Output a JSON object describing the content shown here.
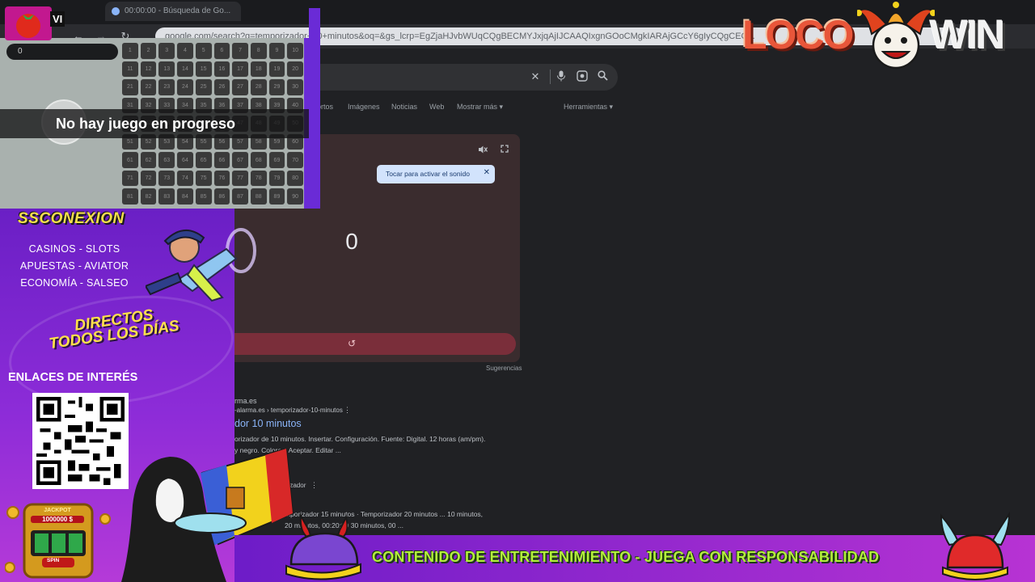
{
  "browser": {
    "tab_title": "00:00:00 - Búsqueda de Go...",
    "url": "google.com/search?q=temporizador+10+minutos&oq=&gs_lcrp=EgZjaHJvbWUqCQgBECMYJxjqAjIJCAAQIxgnGOoCMgkIARAjGCcY6gIyCQgCEC...",
    "tabs": [
      "Imágenes",
      "Noticias",
      "Web",
      "Mostrar más",
      "Herramientas"
    ],
    "tab_partial": "ortos"
  },
  "timer": {
    "value": "0",
    "tooltip": "Tocar para activar el sonido",
    "tooltip_close": "✕",
    "reset": "↺",
    "suggestions": "Sugerencias",
    "label_partial": "t"
  },
  "results": [
    {
      "site": "rma.es",
      "url": "-alarma.es › temporizador-10-minutos",
      "title": "dor 10 minutos",
      "snippet1": "orizador de 10 minutos. Insertar. Configuración. Fuente: Digital. 12 horas (am/pm).",
      "snippet2": "y negro. Colores. Aceptar. Editar ..."
    },
    {
      "site": "porizador",
      "snippet1": "mporizador 15 minutos · Temporizador 20 minutos ... 10 minutos,",
      "snippet2": "20 minutos, 00:20:00 30 minutos, 00 ..."
    }
  ],
  "bingo": {
    "input_value": "0",
    "status": "No hay juego en progreso",
    "numbers": [
      1,
      2,
      3,
      4,
      5,
      6,
      7,
      8,
      9,
      10,
      11,
      12,
      13,
      14,
      15,
      16,
      17,
      18,
      19,
      20,
      21,
      22,
      23,
      24,
      25,
      26,
      27,
      28,
      29,
      30,
      31,
      32,
      33,
      34,
      35,
      36,
      37,
      38,
      39,
      40,
      41,
      42,
      43,
      44,
      45,
      46,
      47,
      48,
      49,
      50,
      51,
      52,
      53,
      54,
      55,
      56,
      57,
      58,
      59,
      60,
      61,
      62,
      63,
      64,
      65,
      66,
      67,
      68,
      69,
      70,
      71,
      72,
      73,
      74,
      75,
      76,
      77,
      78,
      79,
      80,
      81,
      82,
      83,
      84,
      85,
      86,
      87,
      88,
      89,
      90
    ]
  },
  "panel": {
    "brand": "SSCONEXION",
    "topics": [
      "CASINOS - SLOTS",
      "APUESTAS - AVIATOR",
      "ECONOMÍA - SALSEO"
    ],
    "directos_line1": "DIRECTOS",
    "directos_line2": "TODOS LOS DÍAS",
    "links_title": "ENLACES DE INTERÉS",
    "jackpot_label": "JACKPOT",
    "jackpot_value": "1000000 $",
    "spin_label": "SPIN"
  },
  "ribbon": {
    "disclaimer": "CONTENIDO DE ENTRETENIMIENTO - JUEGA CON RESPONSABILIDAD"
  },
  "logos": {
    "top_left_text": "VI",
    "loco": "LOCO",
    "win": "WIN"
  },
  "icons": {
    "close": "clear-icon",
    "mic": "microphone-icon",
    "lens": "camera-lens-icon",
    "search": "search-icon",
    "mute": "mute-icon",
    "fullscreen": "fullscreen-icon"
  },
  "colors": {
    "panel_purple": "#6a1fc5",
    "ribbon_green": "#b4f03c",
    "timer_reset": "#7a2e3a",
    "tooltip_bg": "#d2e3fc",
    "link_blue": "#8ab4f8"
  }
}
